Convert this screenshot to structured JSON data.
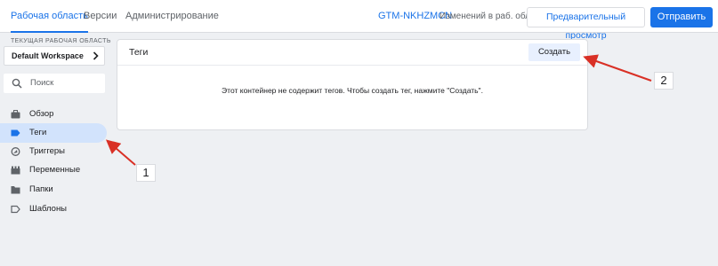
{
  "topbar": {
    "tabs": [
      {
        "label": "Рабочая область",
        "active": true
      },
      {
        "label": "Версии",
        "active": false
      },
      {
        "label": "Администрирование",
        "active": false
      }
    ],
    "container_id": "GTM-NKHZMCN",
    "changes_text": "Изменений в раб. обл.: 0",
    "preview_label": "Предварительный просмотр",
    "submit_label": "Отправить"
  },
  "sidebar": {
    "workspace_label": "ТЕКУЩАЯ РАБОЧАЯ ОБЛАСТЬ",
    "workspace_name": "Default Workspace",
    "search_placeholder": "Поиск",
    "items": [
      {
        "label": "Обзор",
        "icon": "briefcase-icon",
        "active": false
      },
      {
        "label": "Теги",
        "icon": "tag-icon",
        "active": true
      },
      {
        "label": "Триггеры",
        "icon": "trigger-icon",
        "active": false
      },
      {
        "label": "Переменные",
        "icon": "variables-icon",
        "active": false
      },
      {
        "label": "Папки",
        "icon": "folder-icon",
        "active": false
      },
      {
        "label": "Шаблоны",
        "icon": "template-icon",
        "active": false
      }
    ]
  },
  "main": {
    "card_title": "Теги",
    "create_label": "Создать",
    "empty_message": "Этот контейнер не содержит тегов. Чтобы создать тег, нажмите \"Создать\"."
  },
  "annotations": {
    "callout_1": "1",
    "callout_2": "2",
    "arrow_color": "#d93025"
  },
  "colors": {
    "accent": "#1a73e8",
    "active_nav_bg": "#d2e3fc",
    "create_btn_bg": "#e8f0fe"
  }
}
